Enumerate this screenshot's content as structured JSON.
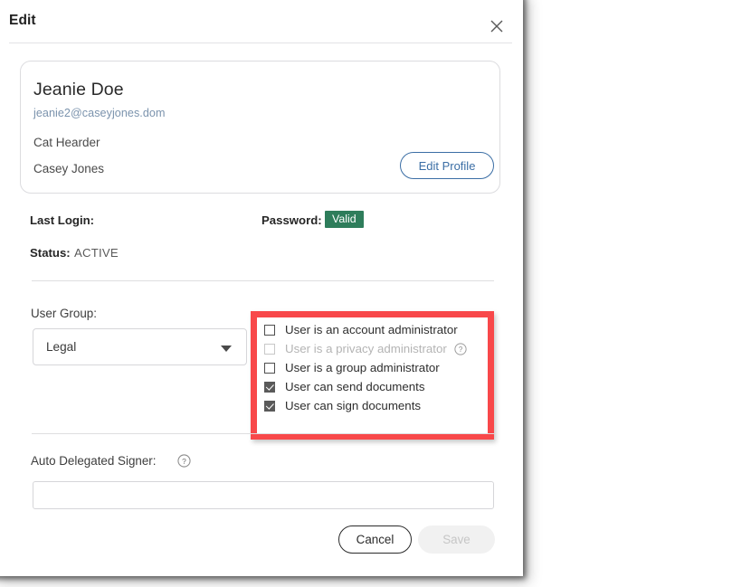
{
  "dialog": {
    "title": "Edit",
    "close_icon": "close-icon"
  },
  "profile": {
    "name": "Jeanie Doe",
    "email": "jeanie2@caseyjones.dom",
    "role": "Cat Hearder",
    "company": "Casey Jones",
    "edit_profile_label": "Edit Profile"
  },
  "meta": {
    "last_login_label": "Last Login:",
    "last_login_value": "",
    "password_label": "Password:",
    "password_badge": "Valid",
    "password_badge_color": "#2e7d5b",
    "status_label": "Status:",
    "status_value": "ACTIVE"
  },
  "user_group": {
    "label": "User Group:",
    "selected": "Legal",
    "caret_icon": "chevron-down-icon"
  },
  "permissions": {
    "highlight_color": "#f8484a",
    "items": [
      {
        "label": "User is an account administrator",
        "checked": false,
        "disabled": false,
        "help": false
      },
      {
        "label": "User is a privacy administrator",
        "checked": false,
        "disabled": true,
        "help": true
      },
      {
        "label": "User is a group administrator",
        "checked": false,
        "disabled": false,
        "help": false
      },
      {
        "label": "User can send documents",
        "checked": true,
        "disabled": false,
        "help": false
      },
      {
        "label": "User can sign documents",
        "checked": true,
        "disabled": false,
        "help": false
      }
    ]
  },
  "auto_delegated_signer": {
    "label": "Auto Delegated Signer:",
    "help_icon": "help-circle-icon",
    "value": "",
    "placeholder": ""
  },
  "footer": {
    "cancel_label": "Cancel",
    "save_label": "Save",
    "save_disabled": true
  }
}
